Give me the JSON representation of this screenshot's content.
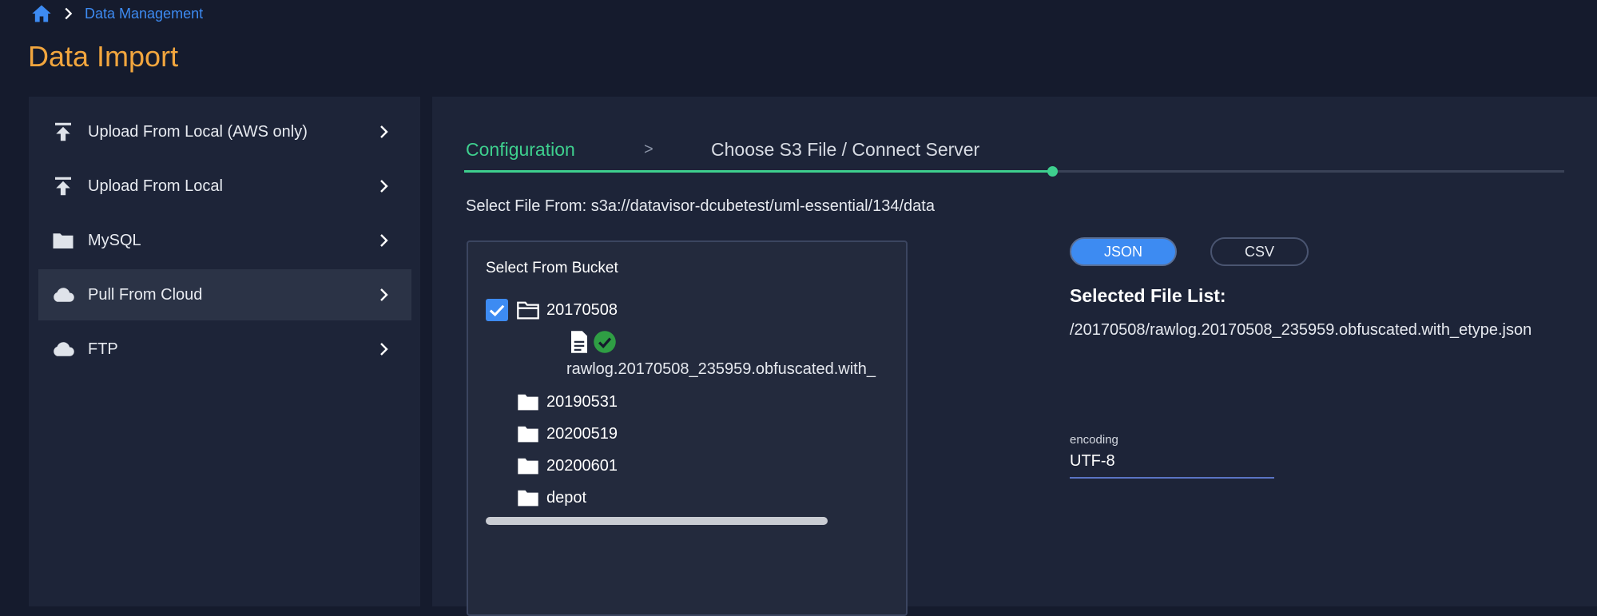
{
  "breadcrumb": {
    "link": "Data Management"
  },
  "page": {
    "title": "Data Import"
  },
  "sidebar": {
    "items": [
      {
        "label": "Upload From Local (AWS only)",
        "icon": "upload-icon"
      },
      {
        "label": "Upload From Local",
        "icon": "upload-icon"
      },
      {
        "label": "MySQL",
        "icon": "folder-icon"
      },
      {
        "label": "Pull From Cloud",
        "icon": "cloud-icon",
        "active": true
      },
      {
        "label": "FTP",
        "icon": "cloud-icon"
      }
    ]
  },
  "steps": {
    "step1": "Configuration",
    "separator": ">",
    "step2": "Choose S3 File / Connect Server",
    "progress": 0.53
  },
  "source": {
    "path_text": "Select File From: s3a://datavisor-dcubetest/uml-essential/134/data"
  },
  "bucket": {
    "title": "Select From Bucket",
    "folders": [
      {
        "name": "20170508",
        "checked": true,
        "expanded": true
      },
      {
        "name": "20190531"
      },
      {
        "name": "20200519"
      },
      {
        "name": "20200601"
      },
      {
        "name": "depot"
      }
    ],
    "file": "rawlog.20170508_235959.obfuscated.with_"
  },
  "format": {
    "options": [
      "JSON",
      "CSV"
    ],
    "selected": "JSON"
  },
  "selected_files": {
    "heading": "Selected File List:",
    "items": [
      "/20170508/rawlog.20170508_235959.obfuscated.with_etype.json"
    ]
  },
  "encoding": {
    "label": "encoding",
    "value": "UTF-8"
  },
  "colors": {
    "accent": "#3d8bf2",
    "title": "#f2a63e",
    "success": "#3ecf8e",
    "background": "#151b2d",
    "panel": "#1d2438"
  }
}
